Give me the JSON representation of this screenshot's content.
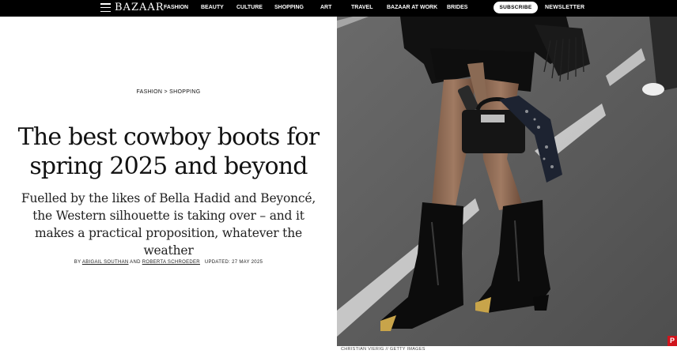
{
  "nav": {
    "logo": "BAZAAR",
    "links": [
      "FASHION",
      "BEAUTY",
      "CULTURE",
      "SHOPPING",
      "ART",
      "TRAVEL",
      "BAZAAR AT WORK",
      "BRIDES"
    ],
    "subscribe": "SUBSCRIBE",
    "newsletter": "NEWSLETTER"
  },
  "article": {
    "breadcrumb_section": "FASHION",
    "breadcrumb_separator": ">",
    "breadcrumb_sub": "SHOPPING",
    "title": "The best cowboy boots for spring 2025 and beyond",
    "dek": "Fuelled by the likes of Bella Hadid and Beyoncé, the Western silhouette is taking over – and it makes a practical proposition, whatever the weather",
    "byline_prefix": "BY",
    "author1": "ABIGAIL SOUTHAN",
    "byline_and": "AND",
    "author2": "ROBERTA SCHROEDER",
    "updated": "UPDATED: 27 MAY 2025"
  },
  "hero": {
    "caption": "CHRISTIAN VIERIG // GETTY IMAGES"
  },
  "icons": {
    "menu": "hamburger-icon",
    "pinterest": "pinterest-icon"
  },
  "colors": {
    "nav_bg": "#000000",
    "pinterest": "#d0141c"
  }
}
